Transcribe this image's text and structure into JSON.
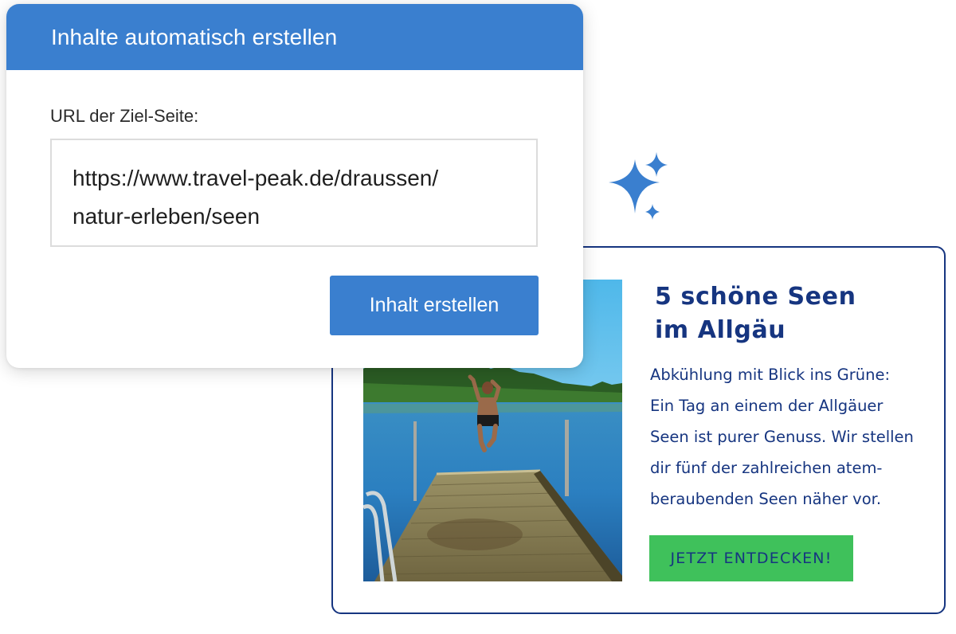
{
  "generator": {
    "title": "Inhalte automatisch erstellen",
    "url_label": "URL der Ziel-Seite:",
    "url_value": "https://www.travel-peak.de/draussen/natur-erleben/seen",
    "url_lines": [
      "https://www.travel-peak.de/draussen/",
      "natur-erleben/seen"
    ],
    "submit_label": "Inhalt erstellen",
    "accent_color": "#3a7fcf"
  },
  "decoration": {
    "icon": "sparkles-icon",
    "color": "#3a7fcf"
  },
  "result": {
    "title_lines": [
      "5 schöne Seen",
      "im Allgäu"
    ],
    "body_lines": [
      "Abkühlung mit Blick ins Grüne:",
      "Ein Tag an einem der Allgäuer",
      "Seen ist purer Genuss. Wir stellen",
      "dir fünf der zahlreichen atem-",
      "beraubenden Seen näher vor."
    ],
    "cta_label": "JETZT ENTDECKEN!",
    "image_icon": "lake-jump-photo",
    "text_color": "#163580",
    "cta_color": "#3fc15b",
    "border_color": "#163580"
  }
}
